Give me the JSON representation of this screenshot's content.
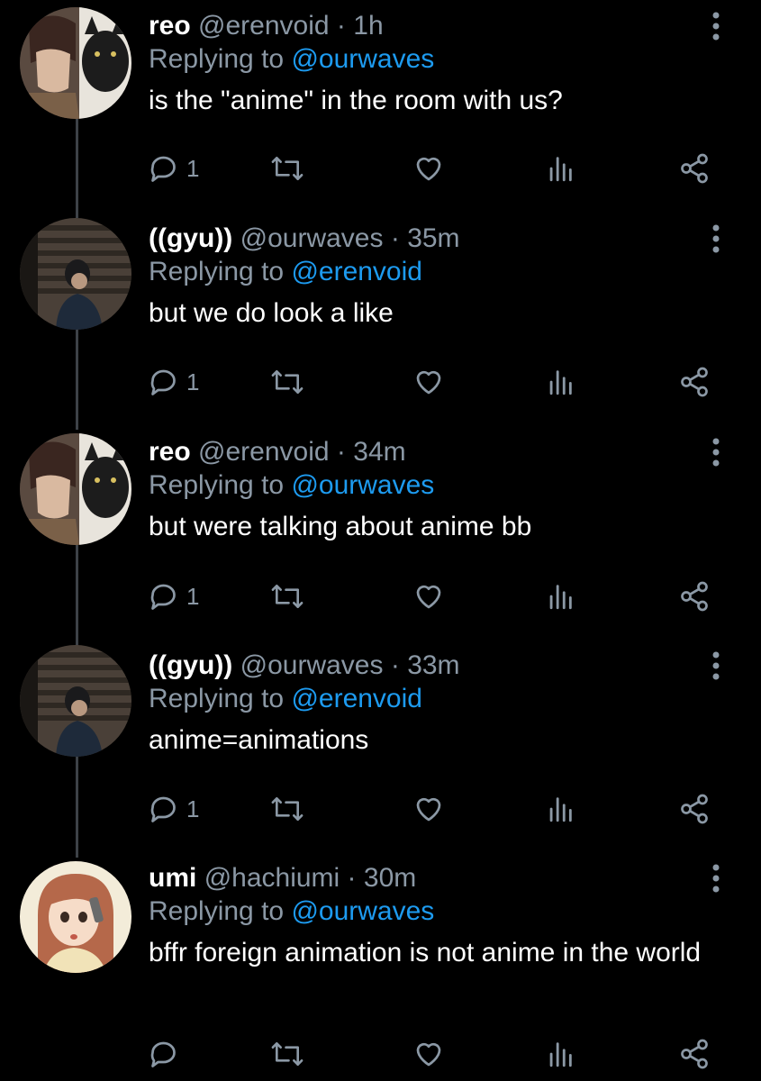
{
  "tweets": [
    {
      "name": "reo",
      "handle": "@erenvoid",
      "separator": "·",
      "time": "1h",
      "replying_prefix": "Replying to",
      "replying_to": "@ourwaves",
      "text": "is the \"anime\" in the room with us?",
      "reply_count": "1",
      "avatar": "anime-character-and-black-cat"
    },
    {
      "name": "((gyu))",
      "handle": "@ourwaves",
      "separator": "·",
      "time": "35m",
      "replying_prefix": "Replying to",
      "replying_to": "@erenvoid",
      "text": "but we do look a like",
      "reply_count": "1",
      "avatar": "person-photo"
    },
    {
      "name": "reo",
      "handle": "@erenvoid",
      "separator": "·",
      "time": "34m",
      "replying_prefix": "Replying to",
      "replying_to": "@ourwaves",
      "text": "but were talking about anime bb",
      "reply_count": "1",
      "avatar": "anime-character-and-black-cat"
    },
    {
      "name": "((gyu))",
      "handle": "@ourwaves",
      "separator": "·",
      "time": "33m",
      "replying_prefix": "Replying to",
      "replying_to": "@erenvoid",
      "text": "anime=animations",
      "reply_count": "1",
      "avatar": "person-photo"
    },
    {
      "name": "umi",
      "handle": "@hachiumi",
      "separator": "·",
      "time": "30m",
      "replying_prefix": "Replying to",
      "replying_to": "@ourwaves",
      "text": "bffr foreign animation is not anime in the world",
      "reply_count": "",
      "avatar": "illustrated-woman-with-phone"
    }
  ],
  "icons": {
    "reply": "reply-icon",
    "retweet": "retweet-icon",
    "like": "heart-icon",
    "views": "analytics-icon",
    "share": "share-icon",
    "more": "more-options-icon"
  },
  "colors": {
    "background": "#000000",
    "text": "#ffffff",
    "secondary": "#8b98a5",
    "mention": "#1d9bf0",
    "thread_line": "#3d4247"
  }
}
